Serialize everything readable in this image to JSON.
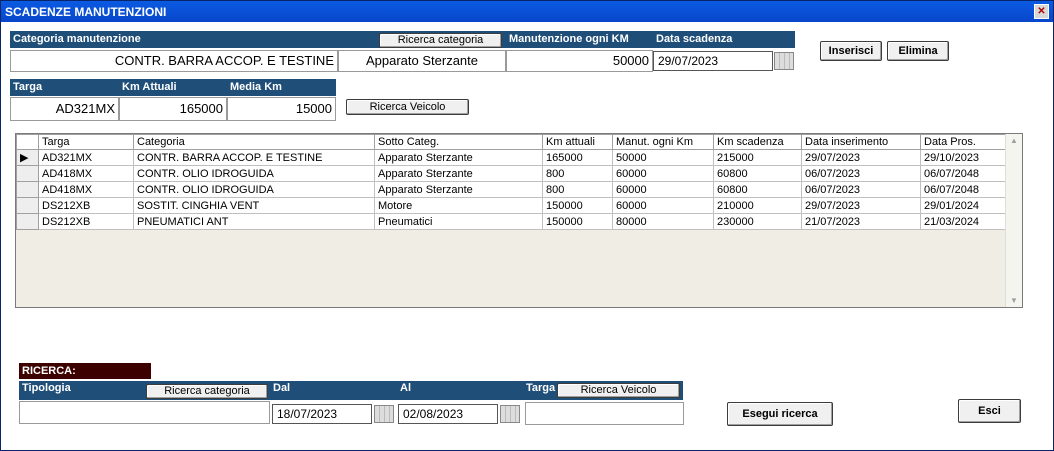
{
  "window": {
    "title": "SCADENZE MANUTENZIONI",
    "close_glyph": "✕"
  },
  "top_form": {
    "categoria_header": "Categoria manutenzione",
    "ricerca_categoria_label": "Ricerca categoria",
    "categoria_value": "CONTR. BARRA ACCOP. E TESTINE",
    "sottocategoria_value": "Apparato Sterzante",
    "manutenzione_header": "Manutenzione ogni KM",
    "manutenzione_value": "50000",
    "data_scadenza_header": "Data scadenza",
    "data_scadenza_value": "29/07/2023",
    "inserisci_label": "Inserisci",
    "elimina_label": "Elimina"
  },
  "vehicle_form": {
    "targa_header": "Targa",
    "targa_value": "AD321MX",
    "km_attuali_header": "Km Attuali",
    "km_attuali_value": "165000",
    "media_km_header": "Media Km",
    "media_km_value": "15000",
    "ricerca_veicolo_label": "Ricerca Veicolo"
  },
  "grid": {
    "selected_row_marker": "▶",
    "columns": [
      "Targa",
      "Categoria",
      "Sotto Categ.",
      "Km attuali",
      "Manut. ogni Km",
      "Km scadenza",
      "Data inserimento",
      "Data Pros."
    ],
    "rows": [
      [
        "AD321MX",
        "CONTR. BARRA ACCOP. E TESTINE",
        "Apparato Sterzante",
        "165000",
        "50000",
        "215000",
        "29/07/2023",
        "29/10/2023"
      ],
      [
        "AD418MX",
        "CONTR. OLIO IDROGUIDA",
        "Apparato Sterzante",
        "800",
        "60000",
        "60800",
        "06/07/2023",
        "06/07/2048"
      ],
      [
        "AD418MX",
        "CONTR. OLIO IDROGUIDA",
        "Apparato Sterzante",
        "800",
        "60000",
        "60800",
        "06/07/2023",
        "06/07/2048"
      ],
      [
        "DS212XB",
        "SOSTIT. CINGHIA VENT",
        "Motore",
        "150000",
        "60000",
        "210000",
        "29/07/2023",
        "29/01/2024"
      ],
      [
        "DS212XB",
        "PNEUMATICI ANT",
        "Pneumatici",
        "150000",
        "80000",
        "230000",
        "21/07/2023",
        "21/03/2024"
      ]
    ]
  },
  "search": {
    "title": "RICERCA:",
    "tipologia_header": "Tipologia",
    "ricerca_categoria_label": "Ricerca categoria",
    "dal_header": "Dal",
    "dal_value": "18/07/2023",
    "al_header": "Al",
    "al_value": "02/08/2023",
    "targa_header": "Targa",
    "ricerca_veicolo_label": "Ricerca Veicolo",
    "esegui_label": "Esegui ricerca",
    "esci_label": "Esci"
  }
}
